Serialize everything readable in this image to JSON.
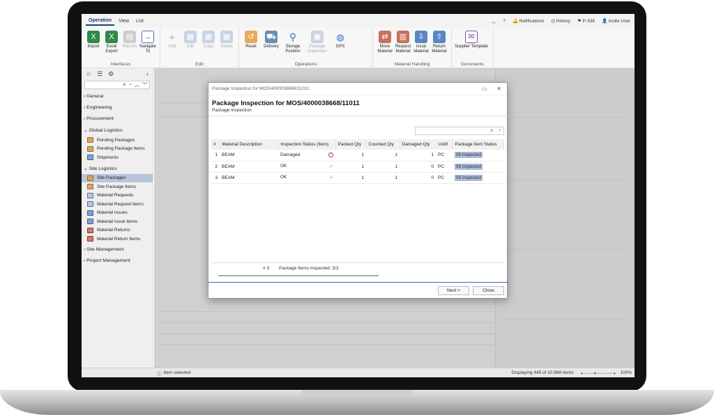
{
  "ribbon_tabs": [
    "Operation",
    "View",
    "List"
  ],
  "topbar": {
    "notifications": "Notifications",
    "history": "History",
    "project": "P-336",
    "user": "Insite User"
  },
  "ribbon": {
    "interfaces": {
      "label": "Interfaces",
      "import": "Import",
      "excel_export": "Excel Export",
      "reports": "Reports",
      "navigate_to": "Navigate To"
    },
    "edit": {
      "label": "Edit",
      "add": "Add",
      "edit": "Edit",
      "copy": "Copy",
      "delete": "Delete"
    },
    "operations": {
      "label": "Operations",
      "reset": "Reset",
      "delivery": "Delivery",
      "storage_position": "Storage Position",
      "package_inspection": "Package Inspection",
      "gps": "GPS"
    },
    "material_handling": {
      "label": "Material Handling",
      "move_material": "Move Material",
      "request_material": "Request Material",
      "issue_material": "Issue Material",
      "return_material": "Return Material"
    },
    "documents": {
      "label": "Documents",
      "supplier_template": "Supplier Template"
    }
  },
  "sidebar": {
    "sections": [
      "General",
      "Engineering",
      "Procurement",
      "Global Logistics",
      "Site Logistics",
      "Site Management",
      "Project Management"
    ],
    "global_logistics": [
      "Pending Packages",
      "Pending Package Items",
      "Shipments"
    ],
    "site_logistics": [
      "Site Packages",
      "Site Package Items",
      "Material Requests",
      "Material Request Items",
      "Material Issues",
      "Material Issue Items",
      "Material Returns",
      "Material Return Items"
    ]
  },
  "statusbar": {
    "left": "Item selected",
    "right": "Displaying 445 of 10.988 items",
    "zoom": "100%"
  },
  "dialog": {
    "window_title": "Package Inspection for MOS/4000038668/11011",
    "title": "Package Inspection for MOS/4000038668/11011",
    "subtitle": "Package Inspection",
    "columns": [
      "#",
      "Material Description",
      "Inspection Status (Item)",
      "Packed Qty",
      "Counted Qty",
      "Damaged Qty",
      "UoM",
      "Package Item Status"
    ],
    "rows": [
      {
        "n": "1",
        "desc": "BEAM",
        "status": "Damaged",
        "packed": "1",
        "counted": "1",
        "damaged": "1",
        "uom": "PC",
        "item_status": "05 Inspected"
      },
      {
        "n": "2",
        "desc": "BEAM",
        "status": "OK",
        "packed": "1",
        "counted": "1",
        "damaged": "0",
        "uom": "PC",
        "item_status": "05 Inspected"
      },
      {
        "n": "3",
        "desc": "BEAM",
        "status": "OK",
        "packed": "1",
        "counted": "1",
        "damaged": "0",
        "uom": "PC",
        "item_status": "05 Inspected"
      }
    ],
    "footer_count": "# 3",
    "footer_summary": "Package Items inspected: 3/3",
    "next_label": "Next >",
    "close_label": "Close"
  }
}
